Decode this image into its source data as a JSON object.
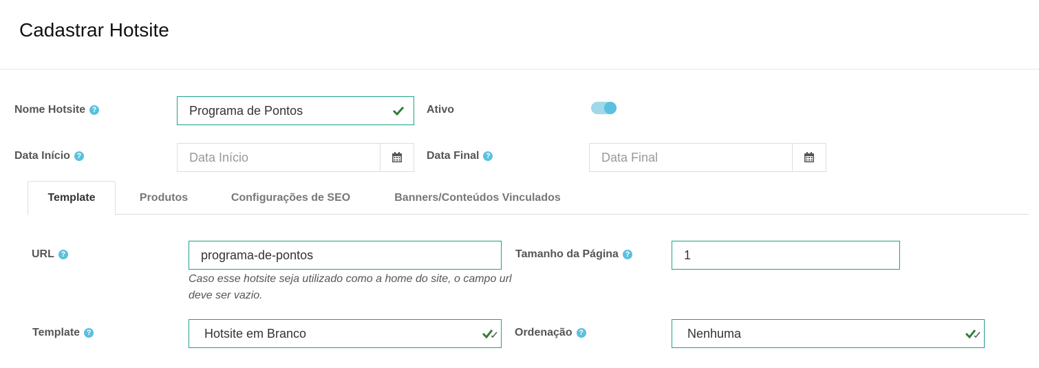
{
  "page": {
    "title": "Cadastrar Hotsite"
  },
  "form": {
    "nome_hotsite": {
      "label": "Nome Hotsite",
      "value": "Programa de Pontos"
    },
    "ativo": {
      "label": "Ativo",
      "checked": true
    },
    "data_inicio": {
      "label": "Data Início",
      "placeholder": "Data Início"
    },
    "data_final": {
      "label": "Data Final",
      "placeholder": "Data Final"
    }
  },
  "tabs": [
    {
      "label": "Template",
      "active": true
    },
    {
      "label": "Produtos",
      "active": false
    },
    {
      "label": "Configurações de SEO",
      "active": false
    },
    {
      "label": "Banners/Conteúdos Vinculados",
      "active": false
    }
  ],
  "template_tab": {
    "url": {
      "label": "URL",
      "value": "programa-de-pontos",
      "hint": "Caso esse hotsite seja utilizado como a home do site, o campo url deve ser vazio."
    },
    "tamanho_pagina": {
      "label": "Tamanho da Página",
      "value": "1"
    },
    "template": {
      "label": "Template",
      "value": "Hotsite em Branco"
    },
    "ordenacao": {
      "label": "Ordenação",
      "value": "Nenhuma"
    }
  },
  "icons": {
    "help": "?",
    "help_icon": "question-circle-icon",
    "calendar_icon": "calendar-icon",
    "check_icon": "check-icon"
  },
  "colors": {
    "accent": "#1aa08a",
    "help": "#5bc0de",
    "check": "#2e7d32"
  }
}
